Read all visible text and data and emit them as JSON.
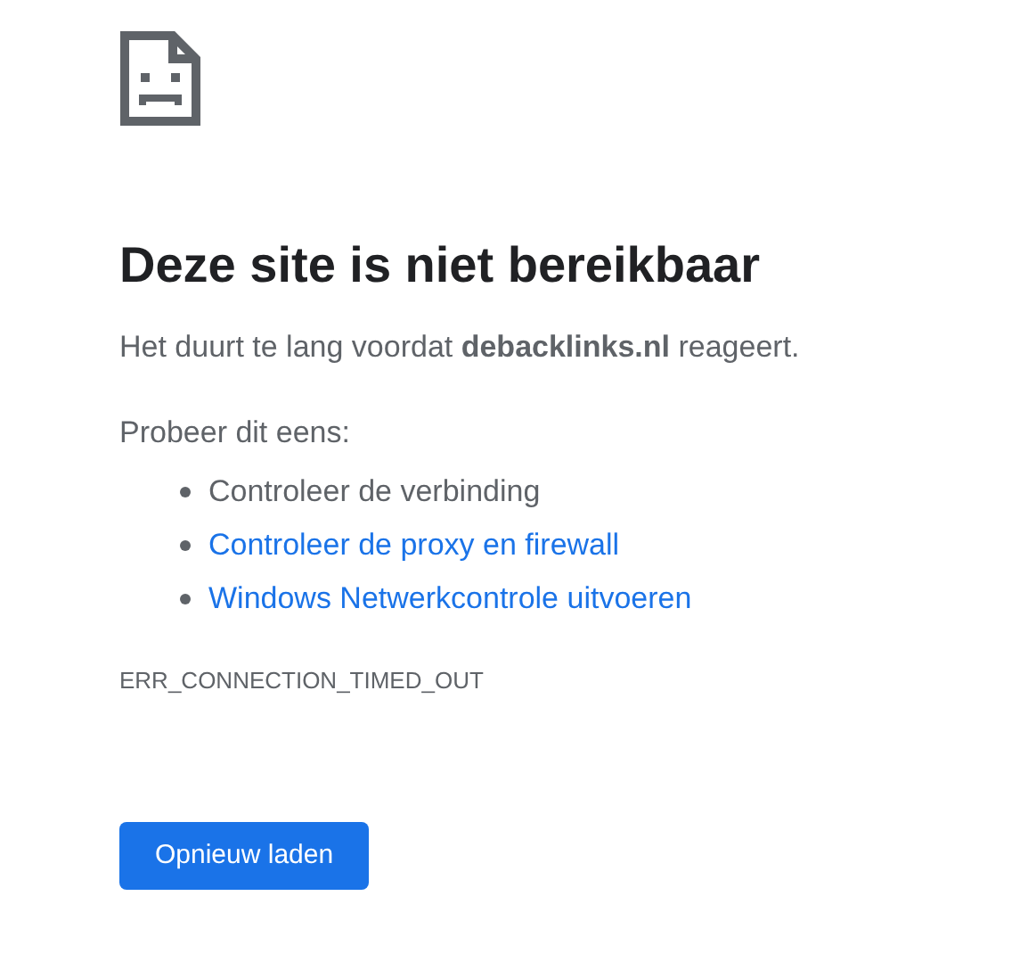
{
  "heading": "Deze site is niet bereikbaar",
  "message": "Het duurt te lang voordat **debacklinks.nl** reageert.",
  "suggestions_heading": "Probeer dit eens:",
  "suggestions": [
    {
      "kind": "text",
      "label": "Controleer de verbinding"
    },
    {
      "kind": "link",
      "label": "Controleer de proxy en firewall"
    },
    {
      "kind": "link",
      "label": "Windows Netwerkcontrole uitvoeren"
    }
  ],
  "error_code": "ERR_CONNECTION_TIMED_OUT",
  "button": {
    "label": "Opnieuw laden"
  }
}
